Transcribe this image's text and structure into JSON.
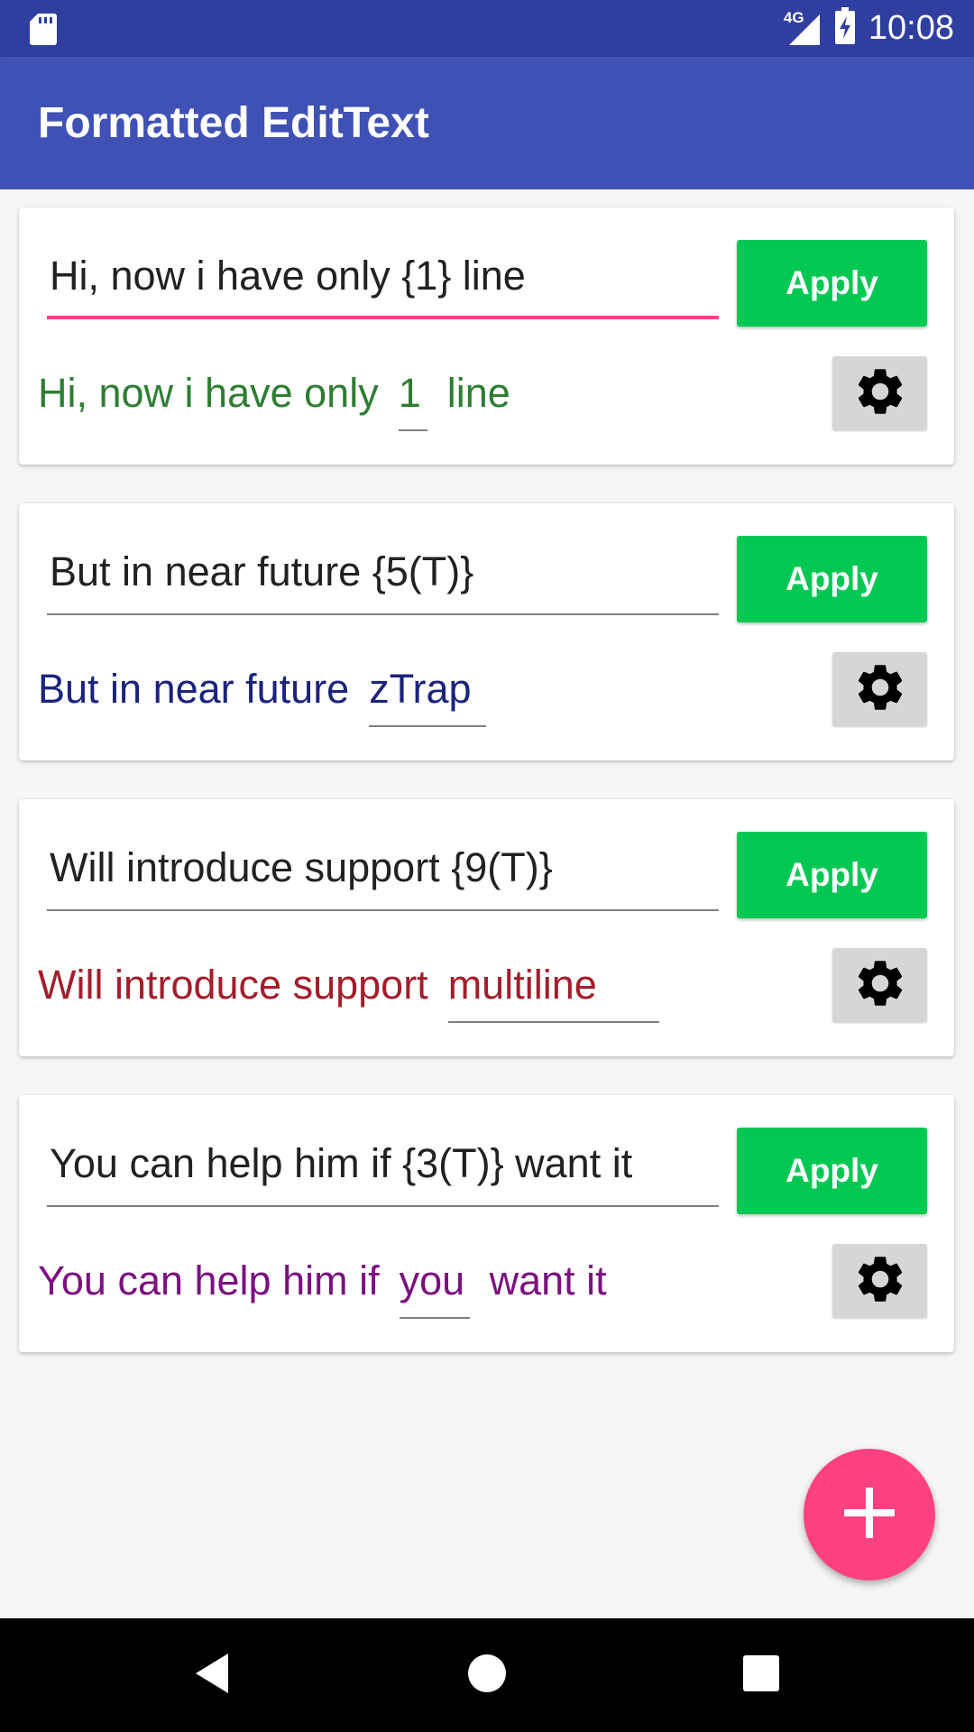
{
  "status_bar": {
    "time": "10:08",
    "network": "4G",
    "icons": [
      "sd-card-icon",
      "signal-icon",
      "battery-charging-icon"
    ]
  },
  "app_bar": {
    "title": "Formatted EditText"
  },
  "colors": {
    "primary": "#3f51b5",
    "primary_dark": "#303f9f",
    "accent": "#ff4081",
    "apply_button": "#00c853"
  },
  "cards": [
    {
      "edit_value": "Hi, now i have only {1} line",
      "apply_label": "Apply",
      "color": "#2e7d32",
      "formatted": {
        "before": "Hi, now i have only",
        "field": "1",
        "after": "line"
      },
      "focused": true
    },
    {
      "edit_value": "But in near future {5(T)}",
      "apply_label": "Apply",
      "color": "#1a237e",
      "formatted": {
        "before": "But in near future",
        "field": "zTrap",
        "after": ""
      },
      "focused": false
    },
    {
      "edit_value": "Will introduce support {9(T)}",
      "apply_label": "Apply",
      "color": "#a31d2b",
      "formatted": {
        "before": "Will introduce support",
        "field": "multiline",
        "after": ""
      },
      "focused": false
    },
    {
      "edit_value": "You can help him if {3(T)} want it",
      "apply_label": "Apply",
      "color": "#7b1080",
      "formatted": {
        "before": "You can help him if",
        "field": "you",
        "after": "want it"
      },
      "focused": false
    }
  ],
  "fab": {
    "icon": "plus-icon"
  },
  "nav_bar": {
    "icons": [
      "back-icon",
      "home-icon",
      "recents-icon"
    ]
  }
}
